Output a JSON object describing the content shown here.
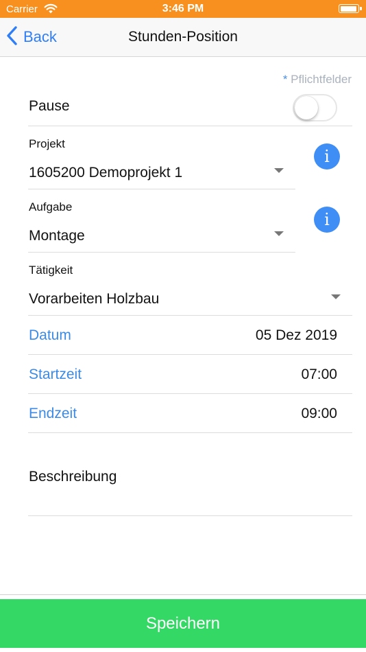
{
  "status_bar": {
    "carrier": "Carrier",
    "time": "3:46 PM",
    "battery_level": 0.95
  },
  "nav": {
    "back_label": "Back",
    "title": "Stunden-Position"
  },
  "form": {
    "required_star": "*",
    "required_note": "Pflichtfelder",
    "pause": {
      "label": "Pause",
      "on": false
    },
    "projekt": {
      "label": "Projekt",
      "value": "1605200 Demoprojekt 1",
      "info_icon": "i"
    },
    "aufgabe": {
      "label": "Aufgabe",
      "value": "Montage",
      "info_icon": "i"
    },
    "taetigkeit": {
      "label": "Tätigkeit",
      "value": "Vorarbeiten Holzbau"
    },
    "datum": {
      "label": "Datum",
      "value": "05 Dez 2019"
    },
    "startzeit": {
      "label": "Startzeit",
      "value": "07:00"
    },
    "endzeit": {
      "label": "Endzeit",
      "value": "09:00"
    },
    "beschreibung": {
      "label": "Beschreibung",
      "value": ""
    }
  },
  "actions": {
    "save_label": "Speichern"
  },
  "colors": {
    "status_bar": "#f7901e",
    "accent_blue": "#3b8ae6",
    "info_blue": "#3f8ef5",
    "save_green": "#34d865"
  },
  "icons": {
    "wifi": "wifi-icon",
    "battery": "battery-icon",
    "back": "chevron-left-icon",
    "info": "info-icon",
    "dropdown": "caret-down-icon"
  }
}
